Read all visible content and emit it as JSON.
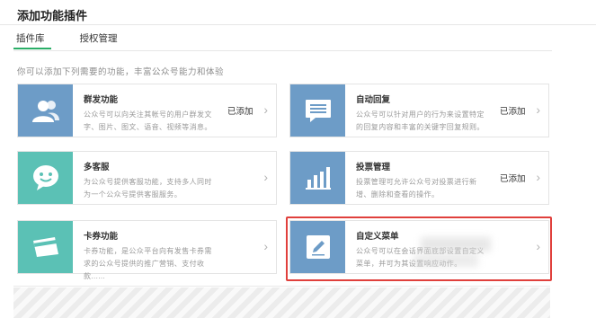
{
  "header": {
    "title": "添加功能插件"
  },
  "tabs": [
    {
      "label": "插件库",
      "active": true
    },
    {
      "label": "授权管理",
      "active": false
    }
  ],
  "intro": "你可以添加下列需要的功能，丰富公众号能力和体验",
  "colors": {
    "accent": "#2aae67",
    "tile_blue": "#6d9cc7",
    "tile_teal": "#5bc1b5",
    "highlight": "#e0403c"
  },
  "plugins": [
    {
      "name": "群发功能",
      "desc": "公众号可以向关注其帐号的用户群发文字、图片、图文、语音、视频等消息。",
      "status": "已添加",
      "icon": "users-icon",
      "color": "blue"
    },
    {
      "name": "自动回复",
      "desc": "公众号可以针对用户的行为来设置特定的回复内容和丰富的关键字回复规则。",
      "status": "已添加",
      "icon": "message-icon",
      "color": "blue"
    },
    {
      "name": "多客服",
      "desc": "为公众号提供客服功能，支持多人同时为一个公众号提供客服服务。",
      "status": "",
      "icon": "chat-face-icon",
      "color": "teal"
    },
    {
      "name": "投票管理",
      "desc": "投票管理可允许公众号对投票进行新增、删除和查看的操作。",
      "status": "已添加",
      "icon": "bar-chart-icon",
      "color": "blue"
    },
    {
      "name": "卡券功能",
      "desc": "卡券功能，是公众平台向有发售卡券需求的公众号提供的推广营销、支付收款......",
      "status": "",
      "icon": "card-icon",
      "color": "teal"
    },
    {
      "name": "自定义菜单",
      "desc": "公众号可以在会话界面底部设置自定义菜单，并可为其设置响应动作。",
      "status": "",
      "icon": "edit-icon",
      "color": "blue"
    }
  ]
}
